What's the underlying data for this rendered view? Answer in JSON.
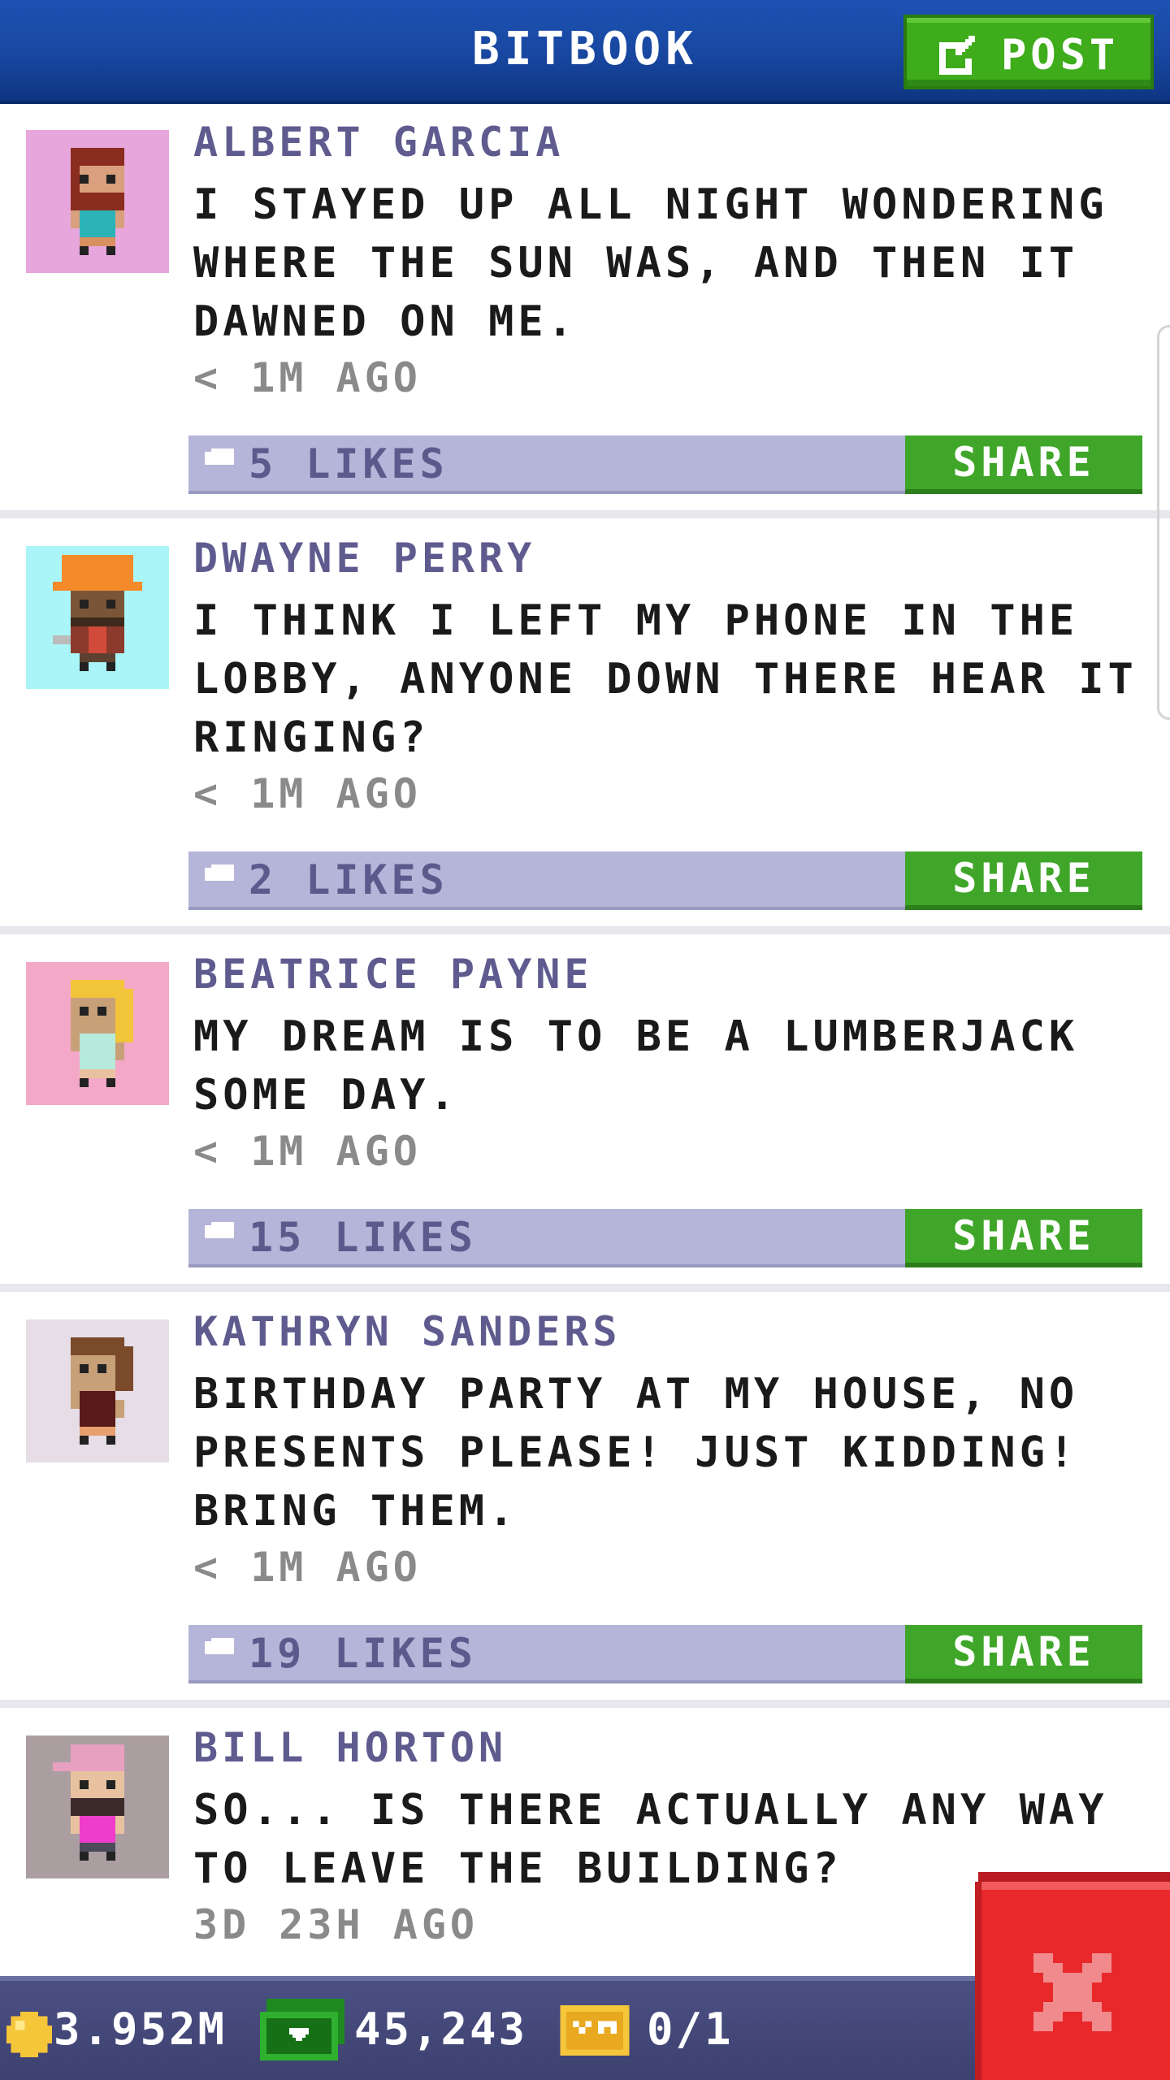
{
  "header": {
    "title": "BITBOOK",
    "post_label": "POST"
  },
  "posts": [
    {
      "author": "ALBERT GARCIA",
      "text": "I STAYED UP ALL NIGHT WONDERING WHERE THE SUN WAS, AND THEN IT DAWNED ON ME.",
      "time": "< 1M AGO",
      "likes": "5 LIKES",
      "share": "SHARE",
      "avatar_bg": "#e7a7dd"
    },
    {
      "author": "DWAYNE PERRY",
      "text": "I THINK I LEFT MY PHONE IN THE LOBBY, ANYONE DOWN THERE HEAR IT RINGING?",
      "time": "< 1M AGO",
      "likes": "2 LIKES",
      "share": "SHARE",
      "avatar_bg": "#a9f5f7"
    },
    {
      "author": "BEATRICE PAYNE",
      "text": "MY DREAM IS TO BE A LUMBERJACK SOME DAY.",
      "time": "< 1M AGO",
      "likes": "15 LIKES",
      "share": "SHARE",
      "avatar_bg": "#f4a8c8"
    },
    {
      "author": "KATHRYN SANDERS",
      "text": "BIRTHDAY PARTY AT MY HOUSE, NO PRESENTS PLEASE! JUST KIDDING! BRING THEM.",
      "time": "< 1M AGO",
      "likes": "19 LIKES",
      "share": "SHARE",
      "avatar_bg": "#e6dde7"
    },
    {
      "author": "BILL HORTON",
      "text": "SO... IS THERE ACTUALLY ANY WAY TO LEAVE THE BUILDING?",
      "time": "3D 23H AGO",
      "avatar_bg": "#ab9ea1"
    }
  ],
  "status": {
    "coins": "3.952M",
    "bux": "45,243",
    "tickets": "0/1"
  },
  "colors": {
    "header_blue": "#1847a0",
    "post_green": "#3fac1c",
    "author_purple": "#5f5b8f",
    "likes_bar": "#b4b5d8",
    "close_red": "#e8282b"
  }
}
